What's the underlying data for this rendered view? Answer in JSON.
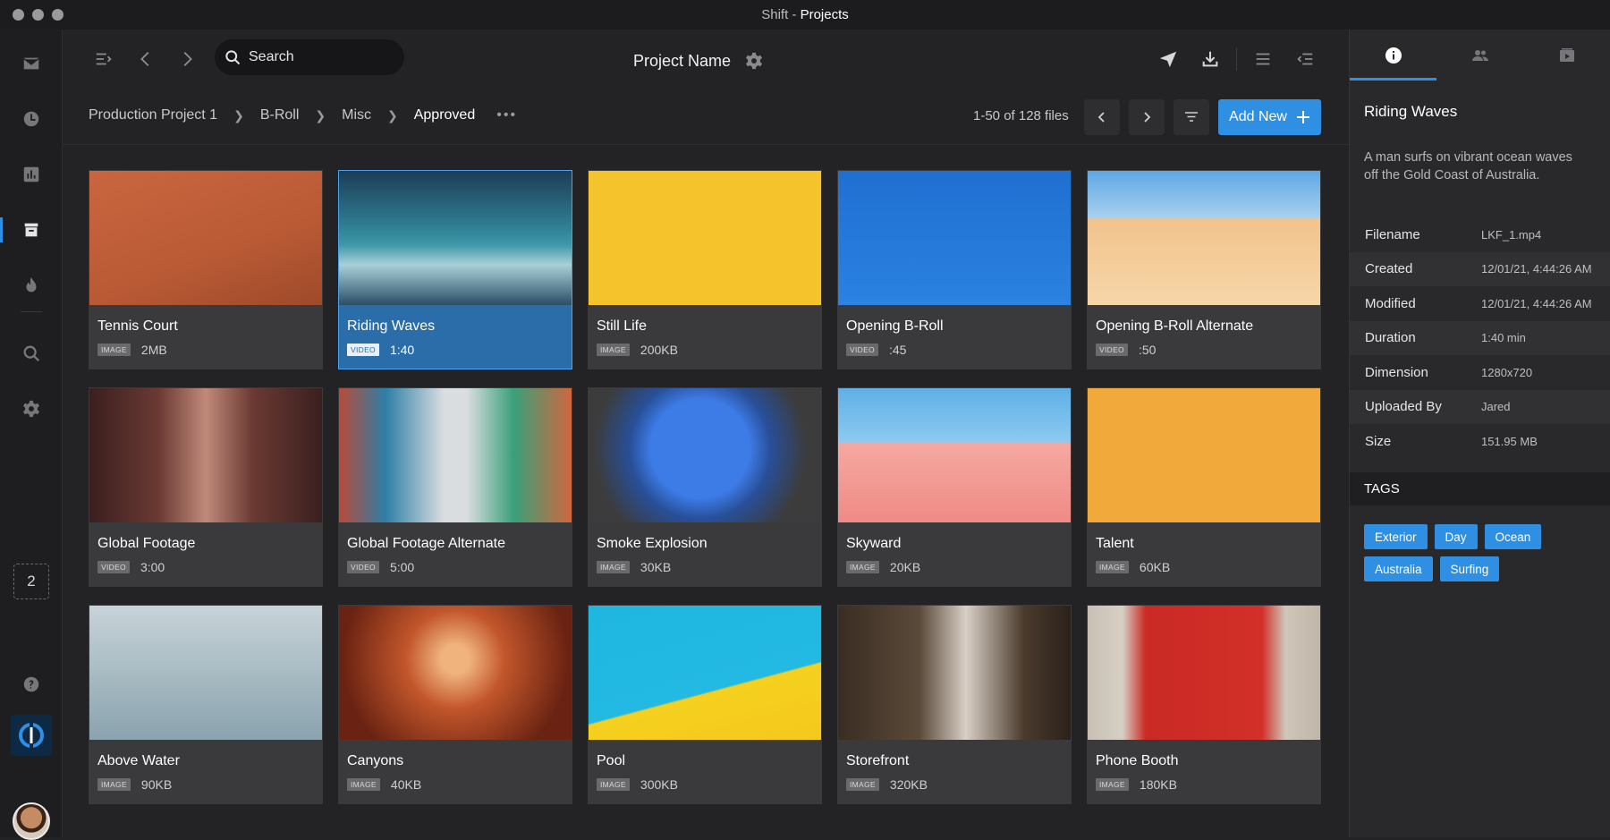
{
  "window": {
    "app": "Shift",
    "separator": "-",
    "section": "Projects"
  },
  "toolbar": {
    "search_placeholder": "Search",
    "project_name": "Project Name"
  },
  "breadcrumb": [
    "Production Project 1",
    "B-Roll",
    "Misc",
    "Approved"
  ],
  "breadcrumb_more": "•••",
  "pagination": {
    "range": "1-50 of 128 files"
  },
  "add_new_label": "Add New",
  "rail": {
    "workspace_badge": "2"
  },
  "files": [
    {
      "title": "Tennis Court",
      "type": "IMAGE",
      "meta": "2MB",
      "thumb": "tennis"
    },
    {
      "title": "Riding Waves",
      "type": "VIDEO",
      "meta": "1:40",
      "thumb": "waves",
      "selected": true
    },
    {
      "title": "Still Life",
      "type": "IMAGE",
      "meta": "200KB",
      "thumb": "still"
    },
    {
      "title": "Opening B-Roll",
      "type": "VIDEO",
      "meta": ":45",
      "thumb": "balloons"
    },
    {
      "title": "Opening B-Roll Alternate",
      "type": "VIDEO",
      "meta": ":50",
      "thumb": "desert"
    },
    {
      "title": "Global Footage",
      "type": "VIDEO",
      "meta": "3:00",
      "thumb": "global"
    },
    {
      "title": "Global Footage Alternate",
      "type": "VIDEO",
      "meta": "5:00",
      "thumb": "canal"
    },
    {
      "title": "Smoke Explosion",
      "type": "IMAGE",
      "meta": "30KB",
      "thumb": "smoke"
    },
    {
      "title": "Skyward",
      "type": "IMAGE",
      "meta": "20KB",
      "thumb": "skyward"
    },
    {
      "title": "Talent",
      "type": "IMAGE",
      "meta": "60KB",
      "thumb": "talent"
    },
    {
      "title": "Above Water",
      "type": "IMAGE",
      "meta": "90KB",
      "thumb": "water"
    },
    {
      "title": "Canyons",
      "type": "IMAGE",
      "meta": "40KB",
      "thumb": "canyon"
    },
    {
      "title": "Pool",
      "type": "IMAGE",
      "meta": "300KB",
      "thumb": "pool"
    },
    {
      "title": "Storefront",
      "type": "IMAGE",
      "meta": "320KB",
      "thumb": "store"
    },
    {
      "title": "Phone Booth",
      "type": "IMAGE",
      "meta": "180KB",
      "thumb": "phone"
    }
  ],
  "details": {
    "title": "Riding Waves",
    "description": "A man surfs on vibrant ocean waves off the Gold Coast of Australia.",
    "rows": [
      {
        "k": "Filename",
        "v": "LKF_1.mp4"
      },
      {
        "k": "Created",
        "v": "12/01/21, 4:44:26 AM"
      },
      {
        "k": "Modified",
        "v": "12/01/21, 4:44:26 AM"
      },
      {
        "k": "Duration",
        "v": "1:40 min"
      },
      {
        "k": "Dimension",
        "v": "1280x720"
      },
      {
        "k": "Uploaded By",
        "v": "Jared"
      },
      {
        "k": "Size",
        "v": "151.95 MB"
      }
    ],
    "tags_heading": "TAGS",
    "tags": [
      "Exterior",
      "Day",
      "Ocean",
      "Australia",
      "Surfing"
    ]
  },
  "colors": {
    "accent": "#2e8fe3",
    "selected_card": "#2a6da8"
  }
}
